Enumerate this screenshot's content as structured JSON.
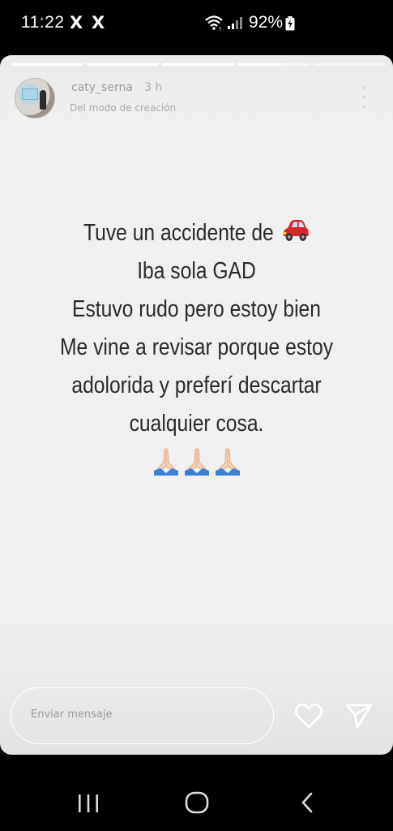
{
  "status_bar": {
    "time": "11:22",
    "notification_icons": [
      "X",
      "X"
    ],
    "battery_percent": "92%",
    "icons": [
      "wifi-icon",
      "signal-icon",
      "battery-charging-icon"
    ]
  },
  "story": {
    "progress_segments": 5,
    "current_segment_progress": [
      1,
      1,
      1,
      0.6,
      0
    ],
    "username": "caty_serna",
    "time_ago": "3 h",
    "subtitle": "Del modo de creación",
    "lines": [
      "Tuve un accidente de",
      "Iba sola GAD",
      "Estuvo rudo pero estoy bien",
      "Me vine a revisar porque estoy",
      "adolorida y preferí descartar",
      "cualquier cosa."
    ],
    "line1_emoji": "car-emoji",
    "closing_emoji": [
      "folded-hands-emoji",
      "folded-hands-emoji",
      "folded-hands-emoji"
    ]
  },
  "message_bar": {
    "placeholder": "Enviar mensaje",
    "icons": [
      "heart-icon",
      "send-icon"
    ]
  },
  "nav_bar": {
    "icons": [
      "recent-apps-icon",
      "home-icon",
      "back-icon"
    ]
  },
  "colors": {
    "story_background": "#f0f0f0",
    "story_text": "#2a2a2a",
    "car_red": "#d9262b"
  }
}
